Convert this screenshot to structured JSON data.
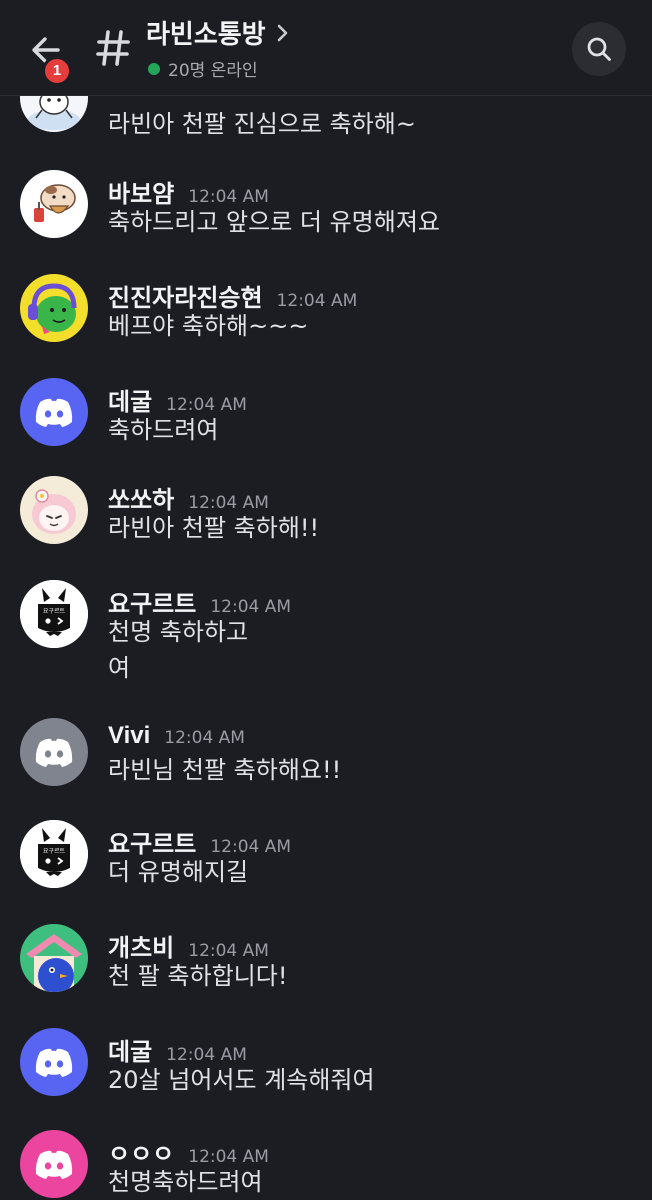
{
  "header": {
    "back_badge": "1",
    "channel_name": "라빈소통방",
    "online_text": "20명 온라인",
    "accent": "#23a55a",
    "icons": [
      "back-arrow-icon",
      "hash-icon",
      "chevron-right-icon",
      "search-icon"
    ]
  },
  "messages": [
    {
      "username": "",
      "time": "",
      "lines": [
        "라빈아 천팔 진심으로 축하해~"
      ]
    },
    {
      "username": "바보얌",
      "time": "12:04 AM",
      "lines": [
        "축하드리고 앞으로 더 유명해져요"
      ]
    },
    {
      "username": "진진자라진승현",
      "time": "12:04 AM",
      "lines": [
        "베프야 축하해~~~"
      ]
    },
    {
      "username": "데굴",
      "time": "12:04 AM",
      "lines": [
        "축하드려여"
      ]
    },
    {
      "username": "쏘쏘하",
      "time": "12:04 AM",
      "lines": [
        "라빈아 천팔 축하해!!"
      ]
    },
    {
      "username": "요구르트",
      "time": "12:04 AM",
      "lines": [
        "천명 축하하고",
        "여"
      ]
    },
    {
      "username": "Vivi",
      "time": "12:04 AM",
      "lines": [
        "라빈님 천팔 축하해요!!"
      ]
    },
    {
      "username": "요구르트",
      "time": "12:04 AM",
      "lines": [
        "더 유명해지길"
      ]
    },
    {
      "username": "개츠비",
      "time": "12:04 AM",
      "lines": [
        "천 팔 축하합니다!"
      ]
    },
    {
      "username": "데굴",
      "time": "12:04 AM",
      "lines": [
        "20살 넘어서도 계속해줘여"
      ]
    },
    {
      "username": "ㅇㅇㅇ",
      "time": "12:04 AM",
      "lines": [
        "천명축하드려여"
      ]
    }
  ],
  "avatar_colors": {
    "discord_blue": "#5865f2",
    "discord_grey": "#80848e",
    "discord_pink": "#eb459f"
  },
  "avatar_icons": [
    "sticker-avatar",
    "hamster-avatar",
    "frog-headset-avatar",
    "discord-logo-icon",
    "pink-bunny-avatar",
    "bunny-logo-avatar",
    "discord-logo-icon",
    "bunny-logo-avatar",
    "bird-house-avatar",
    "discord-logo-icon",
    "discord-logo-icon"
  ],
  "bunny_logo_text": "요구르트"
}
